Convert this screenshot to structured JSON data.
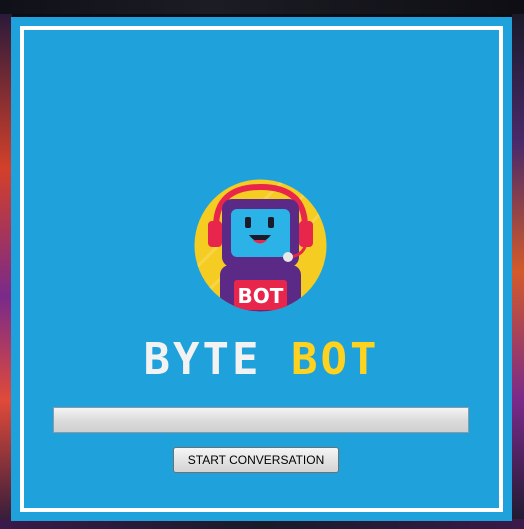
{
  "app": {
    "title_word_1": "BYTE",
    "title_word_2": "BOT",
    "logo_badge_text": "BOT"
  },
  "progress": {
    "value_percent": 0
  },
  "actions": {
    "start_label": "START CONVERSATION"
  },
  "colors": {
    "window_background": "#1fa2dc",
    "frame_border": "#ffffff",
    "title_word_1": "#f2f2f2",
    "title_word_2": "#ffd21f",
    "logo_circle": "#f5cc22",
    "robot_body": "#5b2a86",
    "badge": "#e8254a"
  },
  "icons": {
    "logo": "robot-with-headset-icon"
  }
}
